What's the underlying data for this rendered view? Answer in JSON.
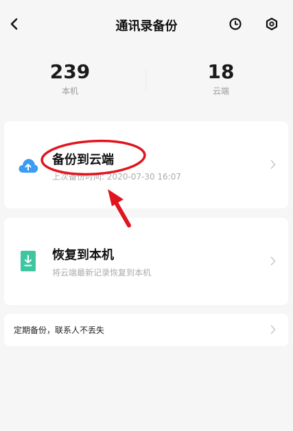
{
  "header": {
    "title": "通讯录备份"
  },
  "stats": {
    "local": {
      "count": "239",
      "label": "本机"
    },
    "cloud": {
      "count": "18",
      "label": "云端"
    }
  },
  "backup": {
    "title": "备份到云端",
    "subtitle": "上次备份时间: 2020-07-30 16:07"
  },
  "restore": {
    "title": "恢复到本机",
    "subtitle": "将云端最新记录恢复到本机"
  },
  "schedule": {
    "text": "定期备份，联系人不丢失"
  },
  "colors": {
    "accent_blue": "#3b9cf4",
    "accent_green": "#3fc6a0",
    "annotation_red": "#e0141e"
  },
  "icons": {
    "back": "chevron-left-icon",
    "history": "clock-icon",
    "settings": "gear-icon",
    "backup": "cloud-upload-icon",
    "restore": "download-file-icon",
    "chevron": "chevron-right-icon"
  }
}
